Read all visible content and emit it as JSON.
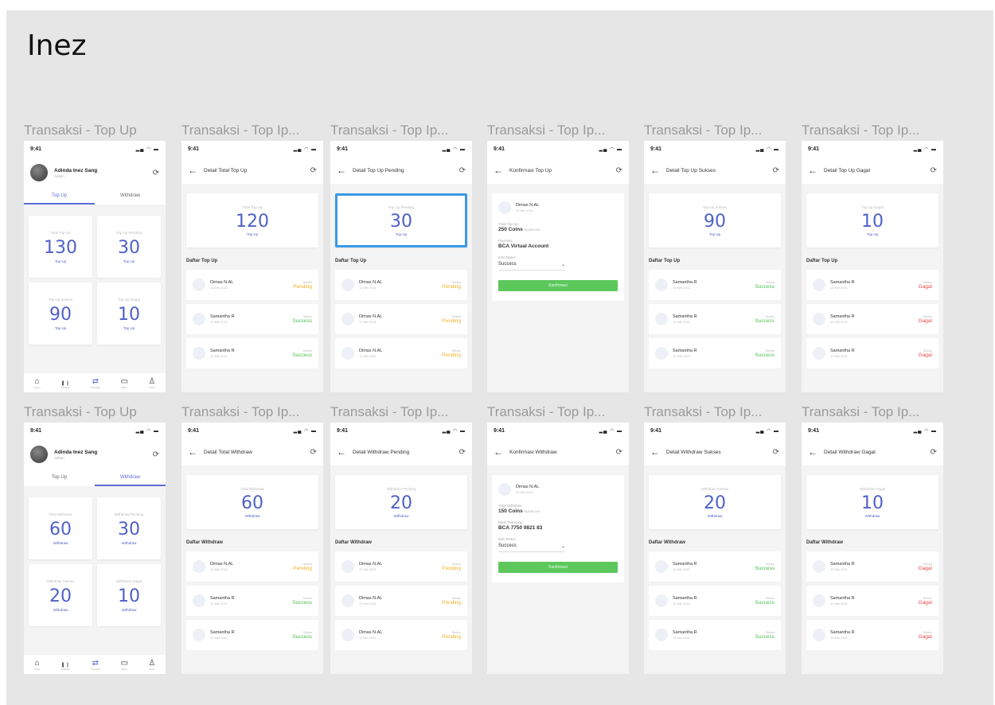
{
  "page": {
    "title": "Inez"
  },
  "frames": [
    {
      "label": "Transaksi - Top Up",
      "type": "dashboard",
      "profile_name": "Adinda Inez Sang",
      "profile_role": "Admin",
      "tab_a": "Top Up",
      "tab_b": "Withdraw",
      "active_tab": "a",
      "cards": [
        {
          "label": "Total Top Up",
          "value": "130",
          "sub": "Top Up"
        },
        {
          "label": "Top Up Pending",
          "value": "30",
          "sub": "Top Up"
        },
        {
          "label": "Top Up Sukses",
          "value": "90",
          "sub": "Top Up"
        },
        {
          "label": "Top Up Gagal",
          "value": "10",
          "sub": "Top Up"
        }
      ],
      "nav": [
        "Home",
        "Statistik",
        "Transaksi",
        "Bank",
        "Akun"
      ]
    },
    {
      "label": "Transaksi - Top Ip...",
      "type": "detail",
      "header": "Detail Total Top Up",
      "card_label": "Total Top Up",
      "card_value": "120",
      "card_sub": "Top Up",
      "list_title": "Daftar Top Up",
      "rows": [
        {
          "name": "Dimas N.AL",
          "date": "12 Mei 2021",
          "status_label": "Status",
          "status": "Pending",
          "kind": "pending"
        },
        {
          "name": "Samantha R",
          "date": "12 Mei 2021",
          "status_label": "Status",
          "status": "Success",
          "kind": "success"
        },
        {
          "name": "Samantha R",
          "date": "12 Mei 2021",
          "status_label": "Status",
          "status": "Success",
          "kind": "success"
        }
      ]
    },
    {
      "label": "Transaksi - Top Ip...",
      "type": "detail",
      "highlight": true,
      "header": "Detail Top Up Pending",
      "card_label": "Top Up Pending",
      "card_value": "30",
      "card_sub": "Top Up",
      "list_title": "Daftar Top Up",
      "rows": [
        {
          "name": "Dimas N.AL",
          "date": "12 Mei 2021",
          "status_label": "Status",
          "status": "Pending",
          "kind": "pending"
        },
        {
          "name": "Dimas N.AL",
          "date": "12 Mei 2021",
          "status_label": "Status",
          "status": "Pending",
          "kind": "pending"
        },
        {
          "name": "Dimas N.AL",
          "date": "12 Mei 2021",
          "status_label": "Status",
          "status": "Pending",
          "kind": "pending"
        }
      ]
    },
    {
      "label": "Transaksi - Top Ip...",
      "type": "confirm",
      "header": "Konfirmasi Top Up",
      "person": "Dimas N.AL",
      "person_date": "12 Mei 2021",
      "f1_label": "Total Top Up",
      "f1_value": "250 Coins",
      "f1_small": "Rp250.000",
      "f2_label": "Payment",
      "f2_value": "BCA Virtual Account",
      "f3_label": "Edit Status",
      "f3_value": "Success",
      "button": "Konfirmasi"
    },
    {
      "label": "Transaksi - Top Ip...",
      "type": "detail",
      "header": "Detail Top Up Sukses",
      "card_label": "Top Up Sukses",
      "card_value": "90",
      "card_sub": "Top Up",
      "list_title": "Daftar Top Up",
      "rows": [
        {
          "name": "Samantha R",
          "date": "12 Mei 2021",
          "status_label": "Status",
          "status": "Success",
          "kind": "success"
        },
        {
          "name": "Samantha R",
          "date": "12 Mei 2021",
          "status_label": "Status",
          "status": "Success",
          "kind": "success"
        },
        {
          "name": "Samantha R",
          "date": "12 Mei 2021",
          "status_label": "Status",
          "status": "Success",
          "kind": "success"
        }
      ]
    },
    {
      "label": "Transaksi - Top Ip...",
      "type": "detail",
      "header": "Detail Top Up Gagal",
      "card_label": "Top Up Gagal",
      "card_value": "10",
      "card_sub": "Top Up",
      "list_title": "Daftar Top Up",
      "rows": [
        {
          "name": "Samantha R",
          "date": "12 Mei 2021",
          "status_label": "Status",
          "status": "Gagal",
          "kind": "gagal"
        },
        {
          "name": "Samantha R",
          "date": "12 Mei 2021",
          "status_label": "Status",
          "status": "Gagal",
          "kind": "gagal"
        },
        {
          "name": "Samantha R",
          "date": "12 Mei 2021",
          "status_label": "Status",
          "status": "Gagal",
          "kind": "gagal"
        }
      ]
    },
    {
      "label": "Transaksi - Top Up",
      "type": "dashboard",
      "profile_name": "Adinda Inez Sang",
      "profile_role": "Admin",
      "tab_a": "Top Up",
      "tab_b": "Withdraw",
      "active_tab": "b",
      "cards": [
        {
          "label": "Total Withdraw",
          "value": "60",
          "sub": "Withdraw"
        },
        {
          "label": "Withdraw Pending",
          "value": "30",
          "sub": "Withdraw"
        },
        {
          "label": "Withdraw Sukses",
          "value": "20",
          "sub": "Withdraw"
        },
        {
          "label": "Withdraw Gagal",
          "value": "10",
          "sub": "Withdraw"
        }
      ],
      "nav": [
        "Home",
        "Statistik",
        "Transaksi",
        "Bank",
        "Akun"
      ]
    },
    {
      "label": "Transaksi - Top Ip...",
      "type": "detail",
      "header": "Detail Total Withdraw",
      "card_label": "Total Withdraw",
      "card_value": "60",
      "card_sub": "Withdraw",
      "list_title": "Daftar Withdraw",
      "rows": [
        {
          "name": "Dimas N.AL",
          "date": "12 Mei 2021",
          "status_label": "Status",
          "status": "Pending",
          "kind": "pending"
        },
        {
          "name": "Samantha R",
          "date": "12 Mei 2021",
          "status_label": "Status",
          "status": "Success",
          "kind": "success"
        },
        {
          "name": "Samantha R",
          "date": "12 Mei 2021",
          "status_label": "Status",
          "status": "Success",
          "kind": "success"
        }
      ]
    },
    {
      "label": "Transaksi - Top Ip...",
      "type": "detail",
      "header": "Detail Withdraw Pending",
      "card_label": "Withdraw Pending",
      "card_value": "20",
      "card_sub": "Withdraw",
      "list_title": "Daftar Withdraw",
      "rows": [
        {
          "name": "Dimas N.AL",
          "date": "12 Mei 2021",
          "status_label": "Status",
          "status": "Pending",
          "kind": "pending"
        },
        {
          "name": "Dimas N.AL",
          "date": "12 Mei 2021",
          "status_label": "Status",
          "status": "Pending",
          "kind": "pending"
        },
        {
          "name": "Dimas N.AL",
          "date": "12 Mei 2021",
          "status_label": "Status",
          "status": "Pending",
          "kind": "pending"
        }
      ]
    },
    {
      "label": "Transaksi - Top Ip...",
      "type": "confirm",
      "header": "Konfirmasi Withdraw",
      "person": "Dimas N.AL",
      "person_date": "12 Mei 2021",
      "f1_label": "Total Withdraw",
      "f1_value": "150 Coins",
      "f1_small": "Rp150.000",
      "f2_label": "Bank Rekening",
      "f2_value": "BCA 7750 9821 83",
      "f3_label": "Edit Status",
      "f3_value": "Success",
      "button": "Konfirmasi"
    },
    {
      "label": "Transaksi - Top Ip...",
      "type": "detail",
      "header": "Detail Withdraw Sukses",
      "card_label": "Withdraw Sukses",
      "card_value": "20",
      "card_sub": "Withdraw",
      "list_title": "Daftar Withdraw",
      "rows": [
        {
          "name": "Samantha R",
          "date": "12 Mei 2021",
          "status_label": "Status",
          "status": "Success",
          "kind": "success"
        },
        {
          "name": "Samantha R",
          "date": "12 Mei 2021",
          "status_label": "Status",
          "status": "Success",
          "kind": "success"
        },
        {
          "name": "Samantha R",
          "date": "12 Mei 2021",
          "status_label": "Status",
          "status": "Success",
          "kind": "success"
        }
      ]
    },
    {
      "label": "Transaksi - Top Ip...",
      "type": "detail",
      "header": "Detail Withdraw Gagal",
      "card_label": "Withdraw Gagal",
      "card_value": "10",
      "card_sub": "Withdraw",
      "list_title": "Daftar Withdraw",
      "rows": [
        {
          "name": "Samantha R",
          "date": "12 Mei 2021",
          "status_label": "Status",
          "status": "Gagal",
          "kind": "gagal"
        },
        {
          "name": "Samantha R",
          "date": "12 Mei 2021",
          "status_label": "Status",
          "status": "Gagal",
          "kind": "gagal"
        },
        {
          "name": "Samantha R",
          "date": "12 Mei 2021",
          "status_label": "Status",
          "status": "Gagal",
          "kind": "gagal"
        }
      ]
    }
  ],
  "status_bar": {
    "time": "9:41",
    "icons": "signal-wifi-battery"
  },
  "colors": {
    "accent": "#4f60c9",
    "pending": "#f0b323",
    "success": "#4cbf4c",
    "gagal": "#e84a4a",
    "highlight": "#3a9ae8",
    "button": "#5cc85c"
  }
}
